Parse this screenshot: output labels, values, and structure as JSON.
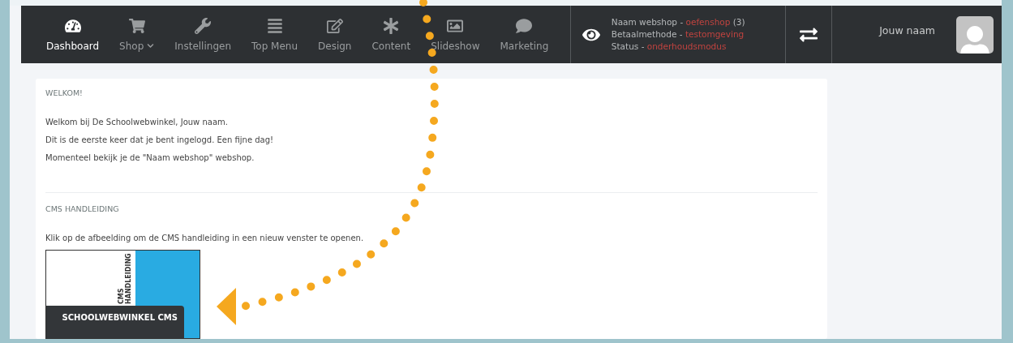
{
  "nav_items": [
    {
      "kind": "dashboard",
      "label": "Dashboard",
      "selected": true,
      "dropdown": false
    },
    {
      "kind": "shop",
      "label": "Shop",
      "selected": false,
      "dropdown": true
    },
    {
      "kind": "settings",
      "label": "Instellingen",
      "selected": false,
      "dropdown": false
    },
    {
      "kind": "menu",
      "label": "Top Menu",
      "selected": false,
      "dropdown": false
    },
    {
      "kind": "design",
      "label": "Design",
      "selected": false,
      "dropdown": false
    },
    {
      "kind": "content",
      "label": "Content",
      "selected": false,
      "dropdown": false
    },
    {
      "kind": "slideshow",
      "label": "Slideshow",
      "selected": false,
      "dropdown": false
    },
    {
      "kind": "marketing",
      "label": "Marketing",
      "selected": false,
      "dropdown": false
    }
  ],
  "webshop_info": [
    {
      "label": "Naam webshop",
      "separator": "-",
      "value": "oefenshop",
      "count": "(3)"
    },
    {
      "label": "Betaalmethode",
      "separator": "-",
      "value": "testomgeving"
    },
    {
      "label": "Status",
      "separator": "-",
      "value": "onderhoudsmodus"
    }
  ],
  "user": {
    "name": "Jouw naam"
  },
  "welcome": {
    "heading": "WELKOM!",
    "paragraphs": [
      "Welkom bij De Schoolwebwinkel, Jouw naam.",
      "Dit is de eerste keer dat je bent ingelogd. Een fijne dag!",
      "Momenteel bekijk je de \"Naam webshop\" webshop."
    ]
  },
  "manual": {
    "heading": "CMS HANDLEIDING",
    "text": "Klik op de afbeelding om de CMS handleiding in een nieuw venster te openen.",
    "cover": {
      "spine_title": "CMS HANDLEIDING",
      "title": "SCHOOLWEBWINKEL CMS"
    }
  }
}
